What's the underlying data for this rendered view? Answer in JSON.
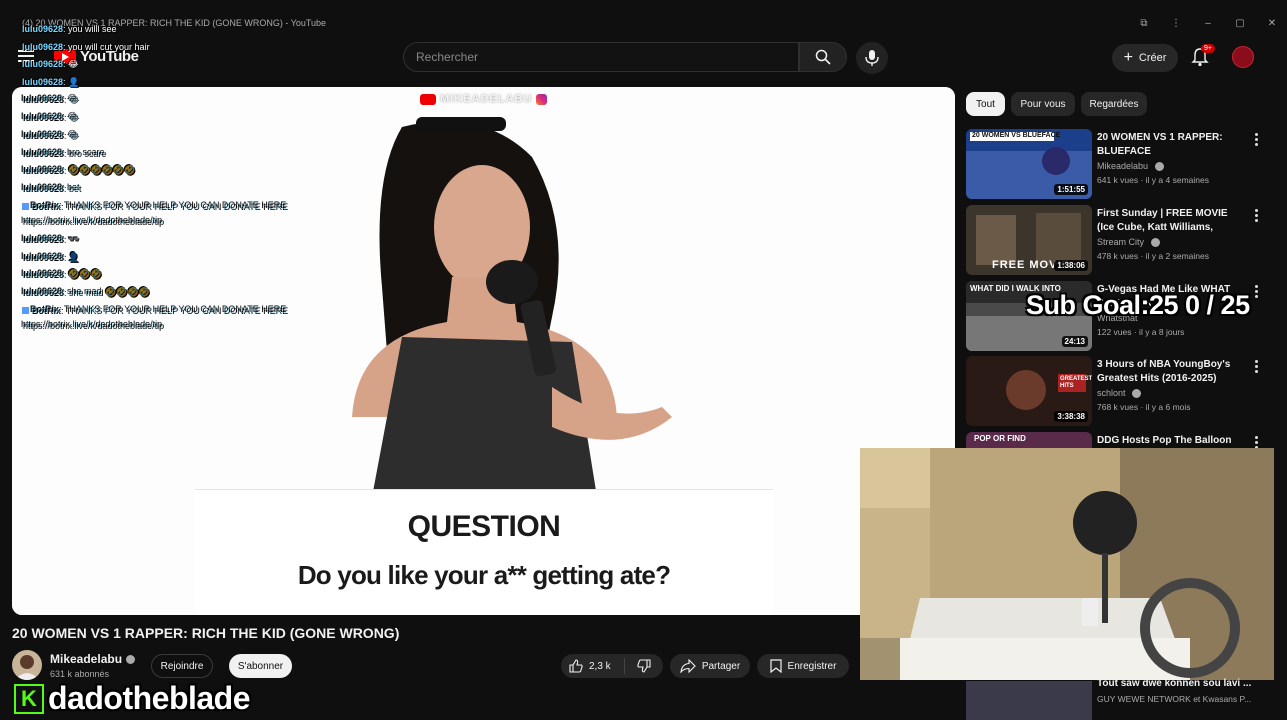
{
  "window": {
    "tab_title": "(4) 20 WOMEN VS 1 RAPPER: RICH THE KID (GONE WRONG) - YouTube"
  },
  "header": {
    "logo_text": "YouTube",
    "search_placeholder": "Rechercher",
    "create_label": "Créer",
    "notification_count": "9+"
  },
  "chat": [
    {
      "user": "lulu09628",
      "msg": ": you willl see",
      "dim": false
    },
    {
      "user": "lulu09628",
      "msg": ": you will cut your hair",
      "dim": false
    },
    {
      "user": "lulu09628",
      "msg": ": 😂",
      "dim": false
    },
    {
      "user": "lulu09628",
      "msg": ": 👤",
      "dim": false
    },
    {
      "user": "lulu09628",
      "msg": ": 😂",
      "dim": true
    },
    {
      "user": "lulu09628",
      "msg": ": 😂",
      "dim": true
    },
    {
      "user": "lulu09628",
      "msg": ": 😂",
      "dim": true
    },
    {
      "user": "lulu09628",
      "msg": ": bro scare",
      "dim": true
    },
    {
      "user": "lulu09628",
      "msg": ": 🤣🤣🤣🤣🤣🤣",
      "dim": true
    },
    {
      "user": "lulu09628",
      "msg": ": bet",
      "dim": true
    },
    {
      "user": "BotRix",
      "msg": ": THANKS FOR YOUR HELP YOU CAN DONATE HERE",
      "dim": true,
      "bot": true
    },
    {
      "user": "",
      "msg": "https://botrix.live/k/dadotheblade/tip",
      "dim": true
    },
    {
      "user": "lulu09628",
      "msg": ": 👓",
      "dim": true
    },
    {
      "user": "lulu09628",
      "msg": ": 👤",
      "dim": true
    },
    {
      "user": "lulu09628",
      "msg": ": 🤣🤣🤣",
      "dim": true
    },
    {
      "user": "lulu09628",
      "msg": ": she mad 🤣🤣🤣🤣",
      "dim": true
    },
    {
      "user": "BotRix",
      "msg": ": THANKS FOR YOUR HELP YOU CAN DONATE HERE",
      "dim": true,
      "bot": true
    },
    {
      "user": "",
      "msg": "https://botrix.live/k/dadotheblade/tip",
      "dim": true
    }
  ],
  "video": {
    "watermark": "MIKEADELABU",
    "question_title": "QUESTION",
    "question_text": "Do you like your a** getting ate?",
    "title": "20 WOMEN VS 1 RAPPER: RICH THE KID (GONE WRONG)",
    "channel": "Mikeadelabu",
    "subscribers": "631 k abonnés",
    "join_label": "Rejoindre",
    "subscribe_label": "S'abonner",
    "likes": "2,3 k",
    "share_label": "Partager",
    "save_label": "Enregistrer"
  },
  "streamer": {
    "name": "dadotheblade",
    "badge": "K"
  },
  "chips": [
    "Tout",
    "Pour vous",
    "Regardées"
  ],
  "recommendations": [
    {
      "title": "20 WOMEN VS 1 RAPPER: BLUEFACE",
      "channel": "Mikeadelabu",
      "verified": true,
      "meta": "641 k vues · il y a 4 semaines",
      "duration": "1:51:55",
      "thumb_text": "20 WOMEN VS BLUEFACE"
    },
    {
      "title": "First Sunday | FREE MOVIE (Ice Cube, Katt Williams, Tracy ...",
      "channel": "Stream City",
      "verified": true,
      "meta": "478 k vues · il y a 2 semaines",
      "duration": "1:38:06",
      "thumb_text": "FREE MOVIE"
    },
    {
      "title": "G-Vegas Had Me Like WHAT DID I WALK INTO",
      "channel": "Whatsthat",
      "verified": false,
      "meta": "122 vues · il y a 8 jours",
      "duration": "24:13",
      "thumb_text": "WHAT DID I WALK INTO"
    },
    {
      "title": "3 Hours of NBA YoungBoy's Greatest Hits (2016-2025)",
      "channel": "schlont",
      "verified": true,
      "meta": "768 k vues · il y a 6 mois",
      "duration": "3:38:38",
      "thumb_text": "GREATEST HITS"
    },
    {
      "title": "DDG Hosts Pop The Balloon or",
      "channel": "",
      "verified": false,
      "meta": "",
      "duration": "",
      "thumb_text": "POP OR FIND"
    }
  ],
  "rec_bottom": {
    "title": "Tout saw dwe konnen sou lavi ...",
    "channel": "GUY WEWE NETWORK",
    "meta": "et Kwasans P..."
  },
  "subgoal": "Sub Goal:25  0 / 25"
}
